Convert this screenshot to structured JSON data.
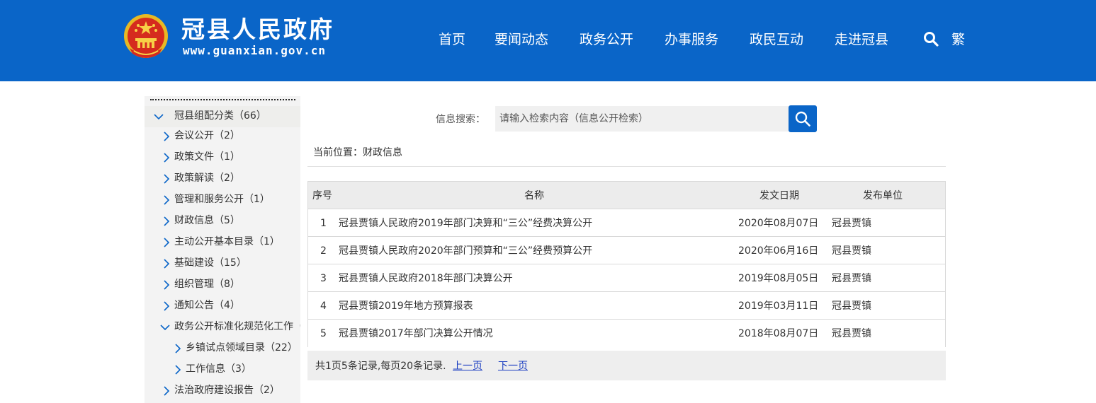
{
  "header": {
    "site_title": "冠县人民政府",
    "site_url": "www.guanxian.gov.cn",
    "brand_color": "#0a65c8",
    "nav": [
      {
        "label": "首页"
      },
      {
        "label": "要闻动态"
      },
      {
        "label": "政务公开"
      },
      {
        "label": "办事服务"
      },
      {
        "label": "政民互动"
      },
      {
        "label": "走进冠县"
      }
    ],
    "search_icon": "search-icon",
    "traditional_toggle": "繁"
  },
  "sidebar": {
    "root": {
      "label": "冠县组配分类（66）",
      "expanded": true
    },
    "items": [
      {
        "label": "会议公开（2）",
        "expanded": false
      },
      {
        "label": "政策文件（1）",
        "expanded": false
      },
      {
        "label": "政策解读（2）",
        "expanded": false
      },
      {
        "label": "管理和服务公开（1）",
        "expanded": false
      },
      {
        "label": "财政信息（5）",
        "expanded": false
      },
      {
        "label": "主动公开基本目录（1）",
        "expanded": false
      },
      {
        "label": "基础建设（15）",
        "expanded": false
      },
      {
        "label": "组织管理（8）",
        "expanded": false
      },
      {
        "label": "通知公告（4）",
        "expanded": false
      },
      {
        "label": "政务公开标准化规范化工作（",
        "expanded": true
      },
      {
        "label": "乡镇试点领域目录（22）",
        "expanded": false,
        "child": true
      },
      {
        "label": "工作信息（3）",
        "expanded": false,
        "child": true
      },
      {
        "label": "法治政府建设报告（2）",
        "expanded": false
      }
    ]
  },
  "search": {
    "label": "信息搜索：",
    "placeholder": "请输入检索内容（信息公开检索）"
  },
  "breadcrumb": "当前位置：财政信息",
  "table": {
    "headers": {
      "index": "序号",
      "name": "名称",
      "date": "发文日期",
      "publisher": "发布单位"
    },
    "rows": [
      {
        "index": "1",
        "name": "冠县贾镇人民政府2019年部门决算和“三公”经费决算公开",
        "date": "2020年08月07日",
        "publisher": "冠县贾镇"
      },
      {
        "index": "2",
        "name": "冠县贾镇人民政府2020年部门预算和“三公”经费预算公开",
        "date": "2020年06月16日",
        "publisher": "冠县贾镇"
      },
      {
        "index": "3",
        "name": "冠县贾镇人民政府2018年部门决算公开",
        "date": "2019年08月05日",
        "publisher": "冠县贾镇"
      },
      {
        "index": "4",
        "name": "冠县贾镇2019年地方预算报表",
        "date": "2019年03月11日",
        "publisher": "冠县贾镇"
      },
      {
        "index": "5",
        "name": "冠县贾镇2017年部门决算公开情况",
        "date": "2018年08月07日",
        "publisher": "冠县贾镇"
      }
    ]
  },
  "pager": {
    "summary": "共1页5条记录,每页20条记录.",
    "prev": "上一页",
    "next": "下一页"
  }
}
